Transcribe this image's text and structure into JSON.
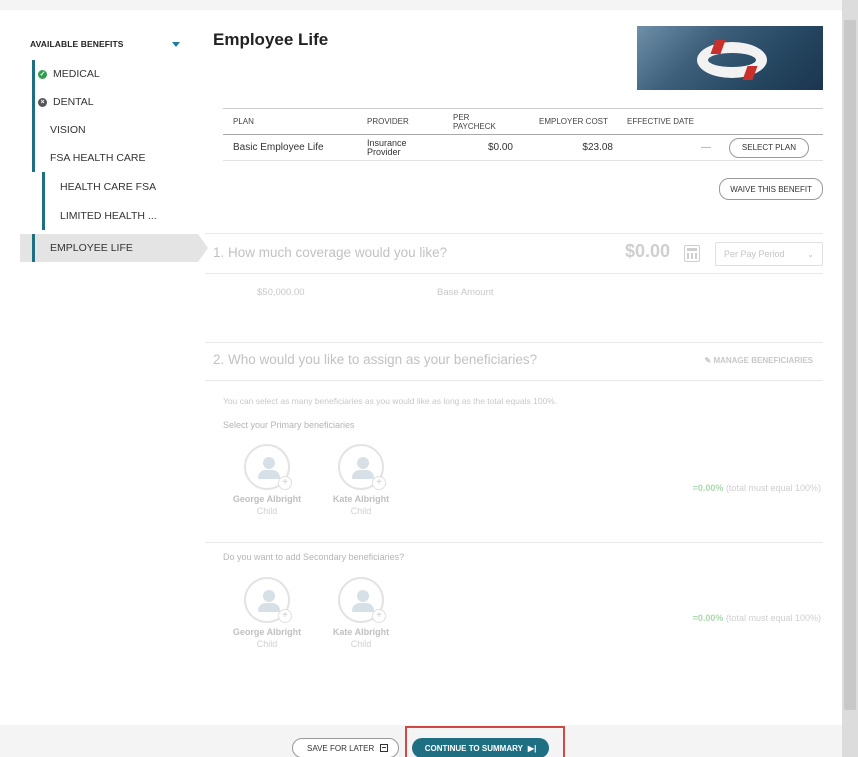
{
  "sidebar": {
    "header": "AVAILABLE BENEFITS",
    "items": [
      {
        "label": "MEDICAL",
        "status": "check"
      },
      {
        "label": "DENTAL",
        "status": "x"
      },
      {
        "label": "VISION"
      },
      {
        "label": "FSA HEALTH CARE"
      },
      {
        "label": "HEALTH CARE FSA"
      },
      {
        "label": "LIMITED HEALTH ..."
      },
      {
        "label": "EMPLOYEE LIFE",
        "active": true
      }
    ]
  },
  "page": {
    "title": "Employee Life"
  },
  "plan_table": {
    "headers": [
      "PLAN",
      "PROVIDER",
      "PER PAYCHECK",
      "EMPLOYER COST",
      "EFFECTIVE DATE"
    ],
    "rows": [
      {
        "plan": "Basic Employee Life",
        "provider_line1": "Insurance",
        "provider_line2": "Provider",
        "per_paycheck": "$0.00",
        "employer_cost": "$23.08",
        "effective_date": "—",
        "action": "SELECT PLAN"
      }
    ],
    "waive_label": "WAIVE THIS BENEFIT"
  },
  "coverage": {
    "question": "1. How much coverage would you like?",
    "amount": "$0.00",
    "period": "Per Pay Period",
    "value": "$50,000.00",
    "value_label": "Base Amount"
  },
  "beneficiaries": {
    "question": "2. Who would you like to assign as your beneficiaries?",
    "manage_label": "MANAGE BENEFICIARIES",
    "hint": "You can select as many beneficiaries as you would like as long as the total equals 100%.",
    "primary_label": "Select your Primary beneficiaries",
    "secondary_label": "Do you want to add Secondary beneficiaries?",
    "primary": [
      {
        "name": "George Albright",
        "relation": "Child"
      },
      {
        "name": "Kate Albright",
        "relation": "Child"
      }
    ],
    "secondary": [
      {
        "name": "George Albright",
        "relation": "Child"
      },
      {
        "name": "Kate Albright",
        "relation": "Child"
      }
    ],
    "primary_pct": "=0.00%",
    "secondary_pct": "=0.00%",
    "pct_note": "(total must equal 100%)"
  },
  "footer": {
    "save_label": "SAVE FOR LATER",
    "continue_label": "CONTINUE TO SUMMARY"
  },
  "colors": {
    "accent": "#1f6f82",
    "highlight": "#d24848"
  }
}
